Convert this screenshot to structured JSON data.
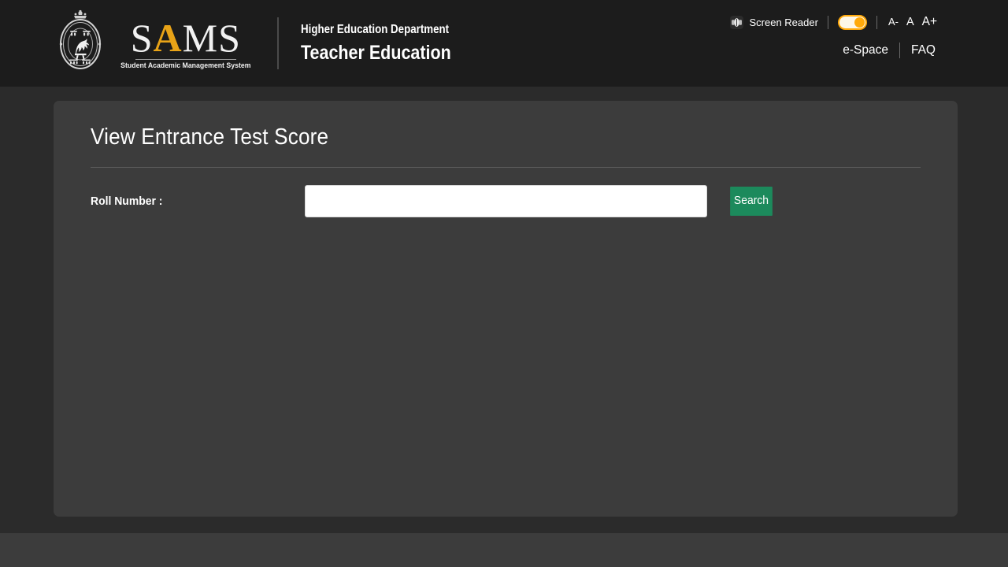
{
  "header": {
    "emblem_alt": "Government of Odisha emblem",
    "brand": {
      "letters": [
        "S",
        "A",
        "M",
        "S"
      ],
      "s1": "S",
      "a": "A",
      "ms": "MS",
      "tagline": "Student Academic Management System",
      "accent_color": "#E8A317"
    },
    "department": {
      "line1": "Higher Education Department",
      "line2": "Teacher Education"
    },
    "accessibility": {
      "screen_reader_label": "Screen Reader",
      "toggle_state": "on",
      "toggle_color": "#FFA90A",
      "font_decrease": "A-",
      "font_normal": "A",
      "font_increase": "A+"
    },
    "nav": [
      {
        "label": "e-Space"
      },
      {
        "label": "FAQ"
      }
    ]
  },
  "main": {
    "card_title": "View Entrance Test Score",
    "form": {
      "roll_number_label": "Roll Number :",
      "roll_number_value": "",
      "roll_number_placeholder": "",
      "search_label": "Search",
      "search_color": "#1C8A5C"
    }
  },
  "theme": {
    "header_bg": "#1c1c1c",
    "page_bg": "#2b2b2b",
    "card_bg": "#3c3c3c",
    "footer_bg": "#3c3c3c",
    "text": "#ffffff"
  }
}
